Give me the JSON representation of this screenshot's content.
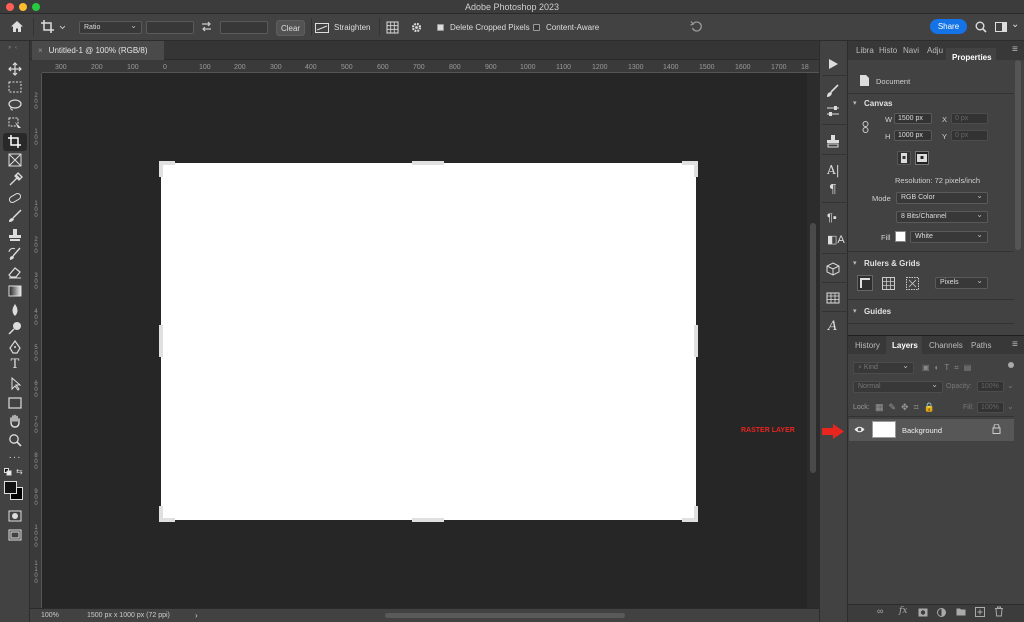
{
  "app": {
    "title": "Adobe Photoshop 2023"
  },
  "options_bar": {
    "ratio_label": "Ratio",
    "clear_label": "Clear",
    "straighten_label": "Straighten",
    "delete_cropped_label": "Delete Cropped Pixels",
    "delete_cropped_checked": true,
    "content_aware_label": "Content-Aware",
    "content_aware_checked": false,
    "share_label": "Share"
  },
  "document": {
    "tab_title": "Untitled-1 @ 100% (RGB/8)",
    "zoom": "100%",
    "size_info": "1500 px x 1000 px (72 ppi)"
  },
  "rulers": {
    "horizontal": [
      "300",
      "200",
      "100",
      "0",
      "100",
      "200",
      "300",
      "400",
      "500",
      "600",
      "700",
      "800",
      "900",
      "1000",
      "1100",
      "1200",
      "1300",
      "1400",
      "1500",
      "1600",
      "1700",
      "18"
    ],
    "vertical": [
      "200",
      "100",
      "0",
      "100",
      "200",
      "300",
      "400",
      "500",
      "600",
      "700",
      "800",
      "900",
      "1000",
      "1100"
    ]
  },
  "properties_panel": {
    "tabs": [
      "Libra",
      "Histo",
      "Navi",
      "Adju",
      "Properties"
    ],
    "active_tab": "Properties",
    "document_label": "Document",
    "canvas_section": "Canvas",
    "w_label": "W",
    "w_value": "1500 px",
    "h_label": "H",
    "h_value": "1000 px",
    "x_label": "X",
    "x_placeholder": "0 px",
    "y_label": "Y",
    "y_placeholder": "0 px",
    "resolution": "Resolution: 72 pixels/inch",
    "mode_label": "Mode",
    "mode_value": "RGB Color",
    "bits_value": "8 Bits/Channel",
    "fill_label": "Fill",
    "fill_value": "White",
    "rulers_section": "Rulers & Grids",
    "units_value": "Pixels",
    "guides_section": "Guides"
  },
  "layers_panel": {
    "tabs": [
      "History",
      "Layers",
      "Channels",
      "Paths"
    ],
    "active_tab": "Layers",
    "kind_placeholder": "Kind",
    "blend_mode": "Normal",
    "opacity_label": "Opacity:",
    "opacity_value": "100%",
    "lock_label": "Lock:",
    "fill_label": "Fill:",
    "fill_value": "100%",
    "layers": [
      {
        "name": "Background",
        "visible": true,
        "locked": true
      }
    ]
  },
  "annotation": {
    "label": "RASTER LAYER",
    "color": "#e8251f"
  },
  "colors": {
    "accent": "#1473e6",
    "canvas": "#ffffff",
    "workspace": "#262626",
    "panel": "#424242"
  }
}
